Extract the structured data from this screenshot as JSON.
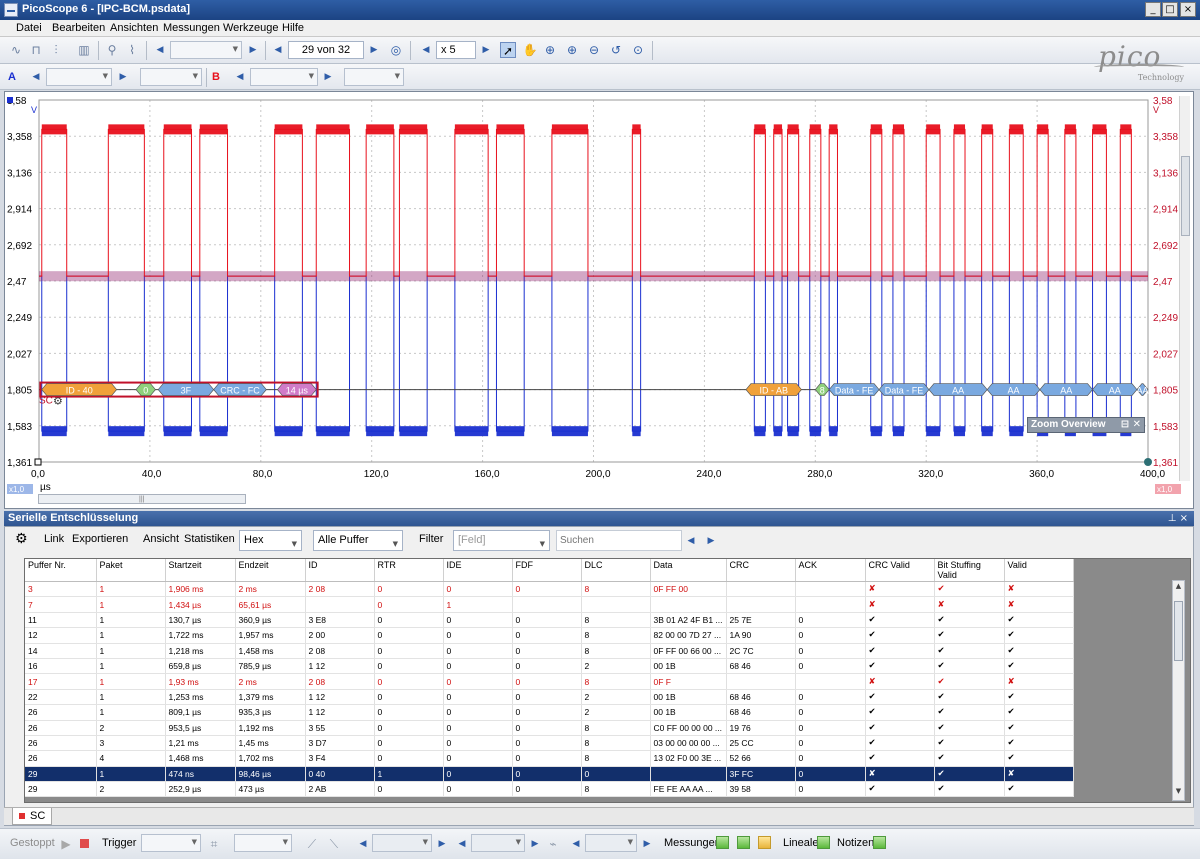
{
  "window": {
    "title": "PicoScope 6 - [IPC-BCM.psdata]",
    "btn_min": "_",
    "btn_max": "□",
    "btn_close": "×"
  },
  "menu": [
    "Datei",
    "Bearbeiten",
    "Ansichten",
    "Messungen",
    "Werkzeuge",
    "Hilfe"
  ],
  "toolbar": {
    "buffer_counter": "29 von 32",
    "zoom_factor": "x 5",
    "channel_a": "A",
    "channel_b": "B"
  },
  "logo": {
    "word": "pico",
    "sub": "Technology"
  },
  "scope": {
    "unit": "V",
    "y_ticks": [
      "3,58",
      "3,358",
      "3,136",
      "2,914",
      "2,692",
      "2,47",
      "2,249",
      "2,027",
      "1,805",
      "1,583",
      "1,361"
    ],
    "x_ticks": [
      "0,0",
      "40,0",
      "80,0",
      "120,0",
      "160,0",
      "200,0",
      "240,0",
      "280,0",
      "320,0",
      "360,0",
      "400,0"
    ],
    "x_unit": "µs",
    "zoom_left": "x1,0",
    "zoom_right": "x1,0",
    "decoder_tag": "SC",
    "packets_left": [
      "ID - 40",
      "0",
      "3F",
      "CRC - FC",
      "14 µs"
    ],
    "packets_right": [
      "ID - AB",
      "8",
      "Data - FE",
      "Data - FE",
      "AA",
      "AA",
      "AA",
      "AA",
      "AA"
    ],
    "zoom_overview": "Zoom Overview",
    "colors": {
      "channel_a": "#1a2fd0",
      "channel_b": "#e8101c"
    }
  },
  "chart_data": {
    "type": "line",
    "xlabel": "µs",
    "ylabel": "V",
    "xlim": [
      0,
      400
    ],
    "ylim": [
      1.361,
      3.58
    ],
    "x_ticks": [
      "0,0",
      "40,0",
      "80,0",
      "120,0",
      "160,0",
      "200,0",
      "240,0",
      "280,0",
      "320,0",
      "360,0",
      "400,0"
    ],
    "y_ticks": [
      "3,58",
      "3,358",
      "3,136",
      "2,914",
      "2,692",
      "2,47",
      "2,249",
      "2,027",
      "1,805",
      "1,583",
      "1,361"
    ],
    "series": [
      {
        "name": "A",
        "color": "#1a2fd0",
        "recessive": 2.5,
        "dominant": 1.55,
        "dominant_intervals": [
          [
            1,
            10
          ],
          [
            25,
            38
          ],
          [
            45,
            55
          ],
          [
            58,
            68
          ],
          [
            85,
            95
          ],
          [
            100,
            112
          ],
          [
            118,
            128
          ],
          [
            130,
            140
          ],
          [
            150,
            162
          ],
          [
            165,
            175
          ],
          [
            185,
            198
          ],
          [
            214,
            217
          ],
          [
            258,
            262
          ],
          [
            265,
            268
          ],
          [
            270,
            274
          ],
          [
            278,
            282
          ],
          [
            285,
            288
          ],
          [
            300,
            304
          ],
          [
            308,
            312
          ],
          [
            320,
            325
          ],
          [
            330,
            334
          ],
          [
            340,
            344
          ],
          [
            350,
            355
          ],
          [
            360,
            364
          ],
          [
            370,
            374
          ],
          [
            380,
            385
          ],
          [
            390,
            394
          ]
        ]
      },
      {
        "name": "B",
        "color": "#e8101c",
        "recessive": 2.5,
        "dominant": 3.4,
        "dominant_intervals": [
          [
            1,
            10
          ],
          [
            25,
            38
          ],
          [
            45,
            55
          ],
          [
            58,
            68
          ],
          [
            85,
            95
          ],
          [
            100,
            112
          ],
          [
            118,
            128
          ],
          [
            130,
            140
          ],
          [
            150,
            162
          ],
          [
            165,
            175
          ],
          [
            185,
            198
          ],
          [
            214,
            217
          ],
          [
            258,
            262
          ],
          [
            265,
            268
          ],
          [
            270,
            274
          ],
          [
            278,
            282
          ],
          [
            285,
            288
          ],
          [
            300,
            304
          ],
          [
            308,
            312
          ],
          [
            320,
            325
          ],
          [
            330,
            334
          ],
          [
            340,
            344
          ],
          [
            350,
            355
          ],
          [
            360,
            364
          ],
          [
            370,
            374
          ],
          [
            380,
            385
          ],
          [
            390,
            394
          ]
        ]
      }
    ]
  },
  "decoder_panel": {
    "title": "Serielle Entschlüsselung",
    "pin": "⊥ ×",
    "toolbar": {
      "link": "Link",
      "export": "Exportieren",
      "view": "Ansicht",
      "stats": "Statistiken",
      "format": "Hex",
      "buffers": "Alle Puffer",
      "filter": "Filter",
      "field": "[Feld]",
      "search_placeholder": "Suchen"
    },
    "columns": [
      "Puffer Nr.",
      "Paket",
      "Startzeit",
      "Endzeit",
      "ID",
      "RTR",
      "IDE",
      "FDF",
      "DLC",
      "Data",
      "CRC",
      "ACK",
      "CRC Valid",
      "Bit Stuffing Valid",
      "Valid"
    ],
    "rows": [
      {
        "c": [
          "3",
          "1",
          "1,906 ms",
          "2 ms",
          "2 08",
          "0",
          "0",
          "0",
          "8",
          "0F FF 00",
          "",
          "",
          "✘",
          "✔",
          "✘"
        ],
        "state": "err"
      },
      {
        "c": [
          "7",
          "1",
          "1,434 µs",
          "65,61 µs",
          "",
          "0",
          "1",
          "",
          "",
          "",
          "",
          "",
          "✘",
          "✘",
          "✘"
        ],
        "state": "err"
      },
      {
        "c": [
          "11",
          "1",
          "130,7 µs",
          "360,9 µs",
          "3 E8",
          "0",
          "0",
          "0",
          "8",
          "3B 01 A2 4F B1 ...",
          "25 7E",
          "0",
          "✔",
          "✔",
          "✔"
        ],
        "state": ""
      },
      {
        "c": [
          "12",
          "1",
          "1,722 ms",
          "1,957 ms",
          "2 00",
          "0",
          "0",
          "0",
          "8",
          "82 00 00 7D 27 ...",
          "1A 90",
          "0",
          "✔",
          "✔",
          "✔"
        ],
        "state": ""
      },
      {
        "c": [
          "14",
          "1",
          "1,218 ms",
          "1,458 ms",
          "2 08",
          "0",
          "0",
          "0",
          "8",
          "0F FF 00 66 00 ...",
          "2C 7C",
          "0",
          "✔",
          "✔",
          "✔"
        ],
        "state": ""
      },
      {
        "c": [
          "16",
          "1",
          "659,8 µs",
          "785,9 µs",
          "1 12",
          "0",
          "0",
          "0",
          "2",
          "00 1B",
          "68 46",
          "0",
          "✔",
          "✔",
          "✔"
        ],
        "state": ""
      },
      {
        "c": [
          "17",
          "1",
          "1,93 ms",
          "2 ms",
          "2 08",
          "0",
          "0",
          "0",
          "8",
          "0F F",
          "",
          "",
          "✘",
          "✔",
          "✘"
        ],
        "state": "err"
      },
      {
        "c": [
          "22",
          "1",
          "1,253 ms",
          "1,379 ms",
          "1 12",
          "0",
          "0",
          "0",
          "2",
          "00 1B",
          "68 46",
          "0",
          "✔",
          "✔",
          "✔"
        ],
        "state": ""
      },
      {
        "c": [
          "26",
          "1",
          "809,1 µs",
          "935,3 µs",
          "1 12",
          "0",
          "0",
          "0",
          "2",
          "00 1B",
          "68 46",
          "0",
          "✔",
          "✔",
          "✔"
        ],
        "state": ""
      },
      {
        "c": [
          "26",
          "2",
          "953,5 µs",
          "1,192 ms",
          "3 55",
          "0",
          "0",
          "0",
          "8",
          "C0 FF 00 00 00 ...",
          "19 76",
          "0",
          "✔",
          "✔",
          "✔"
        ],
        "state": ""
      },
      {
        "c": [
          "26",
          "3",
          "1,21 ms",
          "1,45 ms",
          "3 D7",
          "0",
          "0",
          "0",
          "8",
          "03 00 00 00 00 ...",
          "25 CC",
          "0",
          "✔",
          "✔",
          "✔"
        ],
        "state": ""
      },
      {
        "c": [
          "26",
          "4",
          "1,468 ms",
          "1,702 ms",
          "3 F4",
          "0",
          "0",
          "0",
          "8",
          "13 02 F0 00 3E ...",
          "52 66",
          "0",
          "✔",
          "✔",
          "✔"
        ],
        "state": ""
      },
      {
        "c": [
          "29",
          "1",
          "474 ns",
          "98,46 µs",
          "0 40",
          "1",
          "0",
          "0",
          "0",
          "",
          "3F FC",
          "0",
          "✘",
          "✔",
          "✘"
        ],
        "state": "sel"
      },
      {
        "c": [
          "29",
          "2",
          "252,9 µs",
          "473 µs",
          "2 AB",
          "0",
          "0",
          "0",
          "8",
          "FE FE AA AA ...",
          "39 58",
          "0",
          "✔",
          "✔",
          "✔"
        ],
        "state": ""
      }
    ],
    "tab": "SC"
  },
  "status": {
    "stopped": "Gestoppt",
    "trigger": "Trigger",
    "measurements": "Messungen",
    "rulers": "Lineale",
    "notes": "Notizen"
  }
}
